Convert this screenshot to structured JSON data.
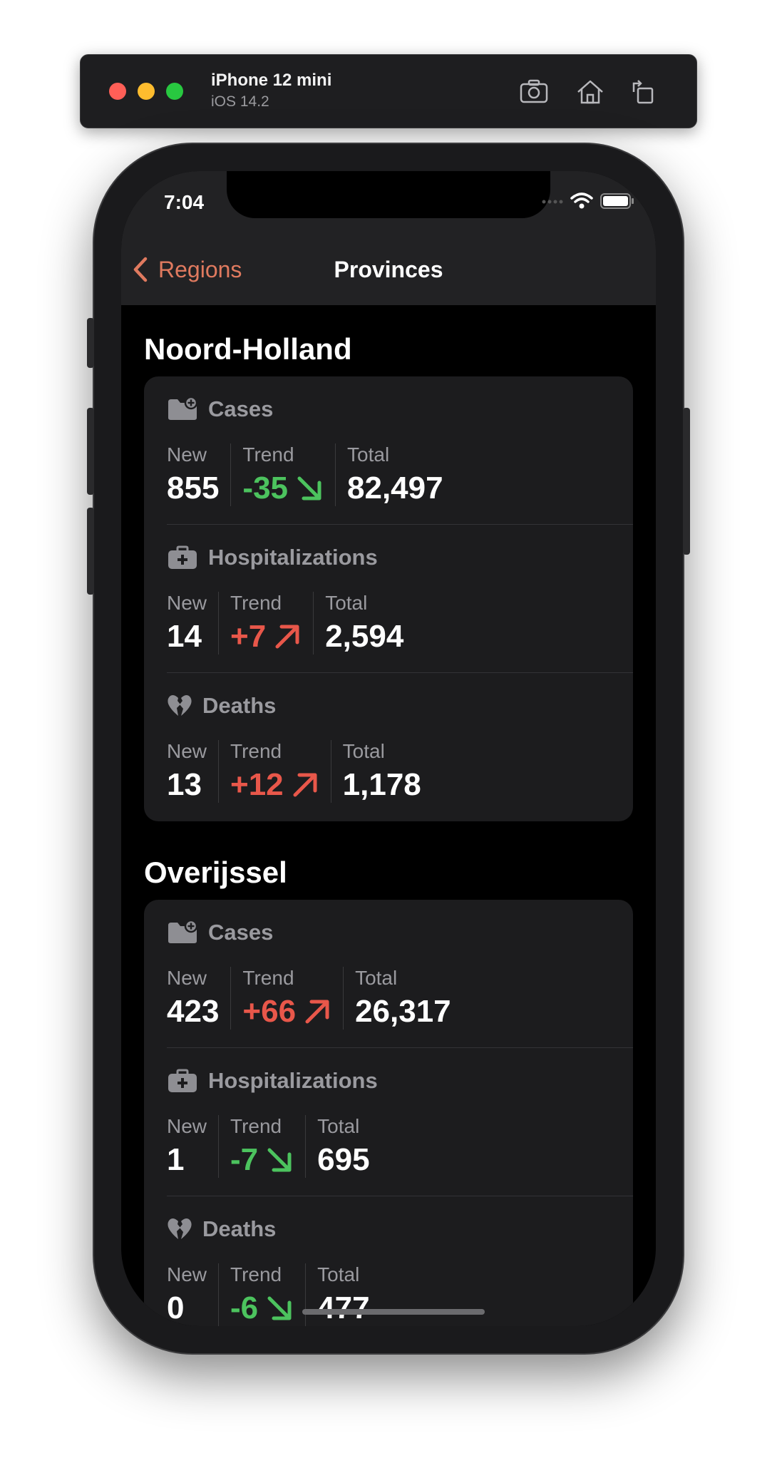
{
  "simulator": {
    "device": "iPhone 12 mini",
    "os": "iOS 14.2",
    "icons": [
      "screenshot-icon",
      "home-icon",
      "rotate-icon"
    ]
  },
  "status_bar": {
    "time": "7:04"
  },
  "nav": {
    "back_label": "Regions",
    "title": "Provinces"
  },
  "colors": {
    "accent": "#e07a5f",
    "down": "#4cc35e",
    "up": "#e8574a",
    "card": "#1c1c1e"
  },
  "provinces": [
    {
      "name": "Noord-Holland",
      "metrics": [
        {
          "label": "Cases",
          "icon": "folder-plus-icon",
          "new_label": "New",
          "new": "855",
          "trend_label": "Trend",
          "trend": "-35",
          "trend_dir": "down",
          "total_label": "Total",
          "total": "82,497"
        },
        {
          "label": "Hospitalizations",
          "icon": "medical-bag-icon",
          "new_label": "New",
          "new": "14",
          "trend_label": "Trend",
          "trend": "+7",
          "trend_dir": "up",
          "total_label": "Total",
          "total": "2,594"
        },
        {
          "label": "Deaths",
          "icon": "broken-heart-icon",
          "new_label": "New",
          "new": "13",
          "trend_label": "Trend",
          "trend": "+12",
          "trend_dir": "up",
          "total_label": "Total",
          "total": "1,178"
        }
      ]
    },
    {
      "name": "Overijssel",
      "metrics": [
        {
          "label": "Cases",
          "icon": "folder-plus-icon",
          "new_label": "New",
          "new": "423",
          "trend_label": "Trend",
          "trend": "+66",
          "trend_dir": "up",
          "total_label": "Total",
          "total": "26,317"
        },
        {
          "label": "Hospitalizations",
          "icon": "medical-bag-icon",
          "new_label": "New",
          "new": "1",
          "trend_label": "Trend",
          "trend": "-7",
          "trend_dir": "down",
          "total_label": "Total",
          "total": "695"
        },
        {
          "label": "Deaths",
          "icon": "broken-heart-icon",
          "new_label": "New",
          "new": "0",
          "trend_label": "Trend",
          "trend": "-6",
          "trend_dir": "down",
          "total_label": "Total",
          "total": "477"
        }
      ]
    }
  ]
}
